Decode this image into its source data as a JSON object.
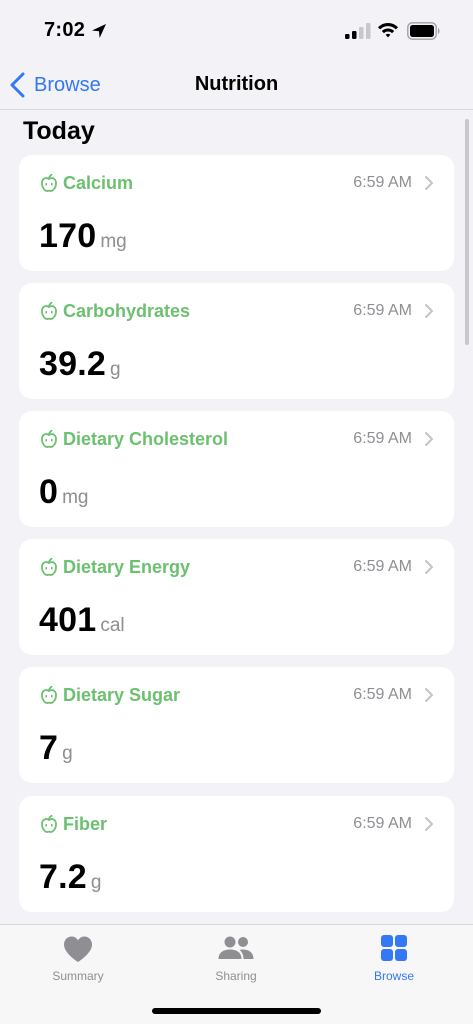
{
  "status_bar": {
    "time": "7:02",
    "icons": [
      "location-arrow-icon",
      "cellular-signal-icon",
      "wifi-icon",
      "battery-icon"
    ]
  },
  "nav": {
    "back_label": "Browse",
    "title": "Nutrition"
  },
  "section": {
    "header": "Today"
  },
  "cards": [
    {
      "title": "Calcium",
      "time": "6:59 AM",
      "value": "170",
      "unit": "mg"
    },
    {
      "title": "Carbohydrates",
      "time": "6:59 AM",
      "value": "39.2",
      "unit": "g"
    },
    {
      "title": "Dietary Cholesterol",
      "time": "6:59 AM",
      "value": "0",
      "unit": "mg"
    },
    {
      "title": "Dietary Energy",
      "time": "6:59 AM",
      "value": "401",
      "unit": "cal"
    },
    {
      "title": "Dietary Sugar",
      "time": "6:59 AM",
      "value": "7",
      "unit": "g"
    },
    {
      "title": "Fiber",
      "time": "6:59 AM",
      "value": "7.2",
      "unit": "g"
    }
  ],
  "tab_bar": {
    "tabs": [
      {
        "label": "Summary",
        "icon": "heart-icon",
        "active": false
      },
      {
        "label": "Sharing",
        "icon": "people-icon",
        "active": false
      },
      {
        "label": "Browse",
        "icon": "grid-icon",
        "active": true
      }
    ]
  },
  "colors": {
    "accent_blue": "#3478F6",
    "nutrition_green": "#6CC070",
    "secondary_gray": "#8E8E93",
    "background": "#F2F2F7"
  }
}
